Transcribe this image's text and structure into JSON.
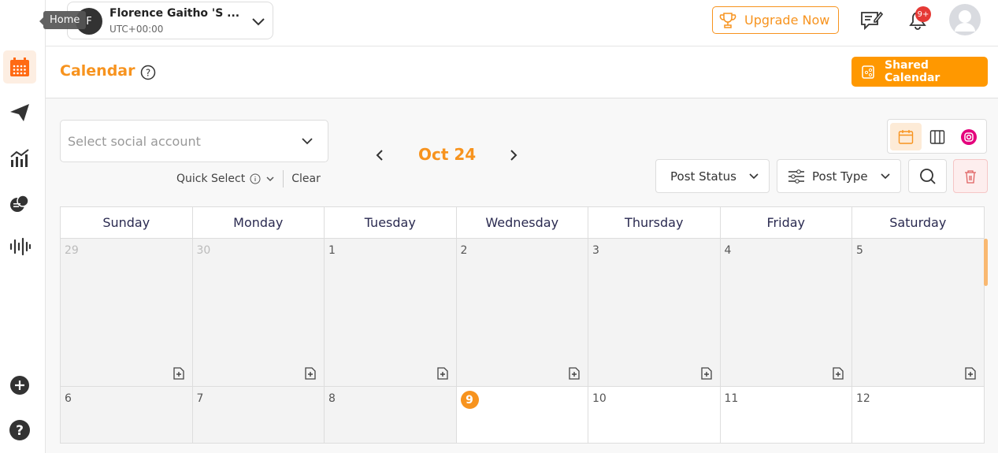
{
  "sidebar": {
    "tooltip": "Home",
    "items": [
      "calendar-icon",
      "send-icon",
      "analytics-icon",
      "chat-icon",
      "audio-wave-icon"
    ],
    "bottom": [
      "add-icon",
      "help-icon"
    ]
  },
  "header": {
    "account_initial": "F",
    "account_name": "Florence Gaitho 'S ...",
    "timezone": "UTC+00:00",
    "upgrade_label": "Upgrade Now",
    "notification_badge": "9+"
  },
  "page": {
    "title": "Calendar",
    "shared_calendar_label": "Shared Calendar"
  },
  "filters": {
    "social_account_placeholder": "Select social account",
    "quick_select": "Quick Select",
    "clear": "Clear",
    "month": "Oct 24",
    "post_status": "Post Status",
    "post_type": "Post Type"
  },
  "calendar": {
    "weekdays": [
      "Sunday",
      "Monday",
      "Tuesday",
      "Wednesday",
      "Thursday",
      "Friday",
      "Saturday"
    ],
    "weeks": [
      [
        "29",
        "30",
        "1",
        "2",
        "3",
        "4",
        "5"
      ],
      [
        "6",
        "7",
        "8",
        "9",
        "10",
        "11",
        "12"
      ]
    ],
    "today": "9"
  },
  "colors": {
    "accent": "#f7931e",
    "button": "#ff9800",
    "badge": "#e53935",
    "instagram": "#e4007c"
  }
}
